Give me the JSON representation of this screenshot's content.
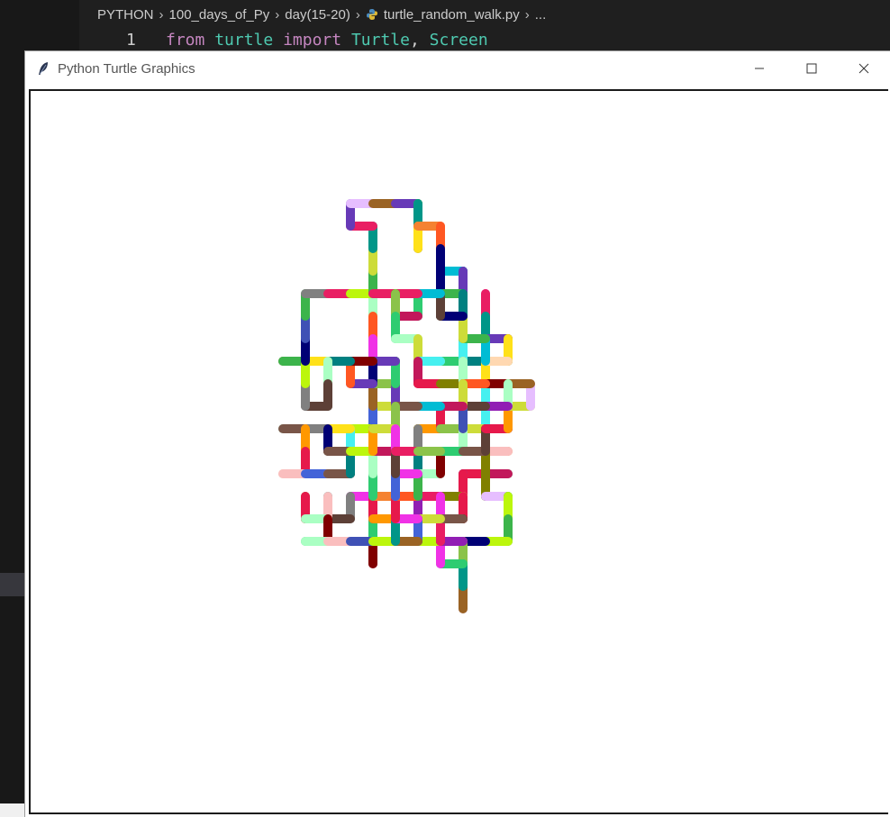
{
  "breadcrumb": {
    "items": [
      "PYTHON",
      "100_days_of_Py",
      "day(15-20)",
      "turtle_random_walk.py",
      "..."
    ]
  },
  "editor": {
    "line_number": "1",
    "tokens": {
      "kw1": "from",
      "module": "turtle",
      "kw2": "import",
      "cls1": "Turtle",
      "comma": ",",
      "cls2": "Screen"
    }
  },
  "window": {
    "title": "Python Turtle Graphics",
    "controls": {
      "minimize": "minimize-icon",
      "maximize": "maximize-icon",
      "close": "close-icon"
    }
  },
  "drawing": {
    "pen_size": 10,
    "segment_length": 25,
    "steps": 420,
    "colors": [
      "#e6194b",
      "#3cb44b",
      "#ffe119",
      "#4363d8",
      "#f58231",
      "#911eb4",
      "#46f0f0",
      "#f032e6",
      "#bcf60c",
      "#fabebe",
      "#008080",
      "#e6beff",
      "#9a6324",
      "#800000",
      "#aaffc3",
      "#808000",
      "#ffd8b1",
      "#000075",
      "#808080",
      "#2ecc71",
      "#e91e63",
      "#00bcd4",
      "#8bc34a",
      "#ff5722",
      "#673ab7",
      "#cddc39",
      "#795548",
      "#3f51b5",
      "#ff9800",
      "#009688",
      "#c2185b",
      "#5d4037"
    ]
  }
}
